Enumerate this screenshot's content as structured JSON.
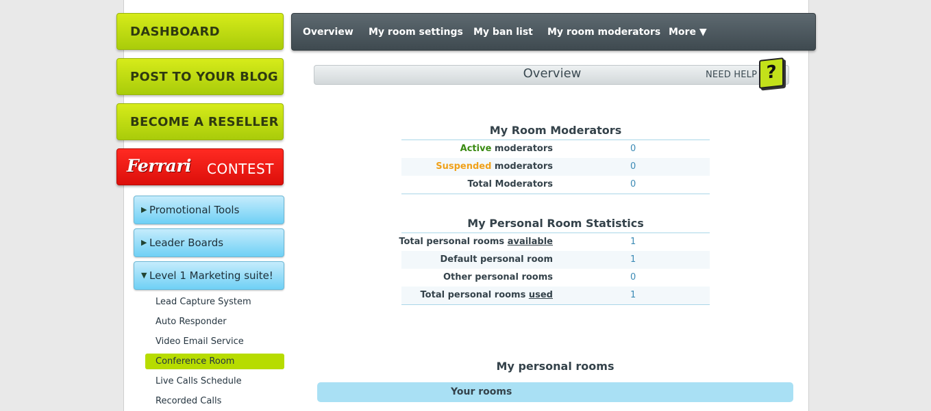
{
  "sidebar": {
    "green_buttons": [
      "DASHBOARD",
      "POST TO YOUR BLOG",
      "BECOME A RESELLER"
    ],
    "contest": {
      "brand": "Ferrari",
      "label": "CONTEST"
    },
    "blue_buttons": [
      {
        "label": "Promotional Tools",
        "arrow": "▶"
      },
      {
        "label": "Leader Boards",
        "arrow": "▶"
      },
      {
        "label": "Level 1 Marketing suite!",
        "arrow": "▼"
      }
    ],
    "sub_items": [
      "Lead Capture System",
      "Auto Responder",
      "Video Email Service",
      "Conference Room",
      "Live Calls Schedule",
      "Recorded Calls"
    ],
    "active_sub_item": "Conference Room"
  },
  "topnav": {
    "items": [
      "Overview",
      "My room settings",
      "My ban list",
      "My room moderators",
      "More ▼"
    ]
  },
  "overview": {
    "title": "Overview",
    "need_help": "NEED HELP",
    "help_icon": "?"
  },
  "moderators": {
    "title": "My Room Moderators",
    "rows": [
      {
        "highlight": "Active",
        "label": " moderators",
        "value": "0"
      },
      {
        "highlight": "Suspended",
        "label": " moderators",
        "value": "0"
      },
      {
        "highlight": "",
        "label": "Total Moderators",
        "value": "0"
      }
    ]
  },
  "stats": {
    "title": "My Personal Room Statistics",
    "rows": [
      {
        "label": "Total personal rooms ",
        "underline": "available",
        "value": "1"
      },
      {
        "label": "Default personal room",
        "underline": "",
        "value": "1"
      },
      {
        "label": "Other personal rooms",
        "underline": "",
        "value": "0"
      },
      {
        "label": "Total personal rooms ",
        "underline": "used",
        "value": "1"
      }
    ]
  },
  "rooms": {
    "title": "My personal rooms",
    "bar_label": "Your rooms"
  },
  "colors": {
    "green_button": "#c3e11a",
    "contest_red": "#ee1c14",
    "blue_button": "#8fdaf7",
    "nav_dark": "#4c575d",
    "active_highlight": "#b7dc00",
    "active_text": "#3a8a12",
    "suspended_text": "#f0a11a",
    "value_text": "#3b8ab5"
  }
}
